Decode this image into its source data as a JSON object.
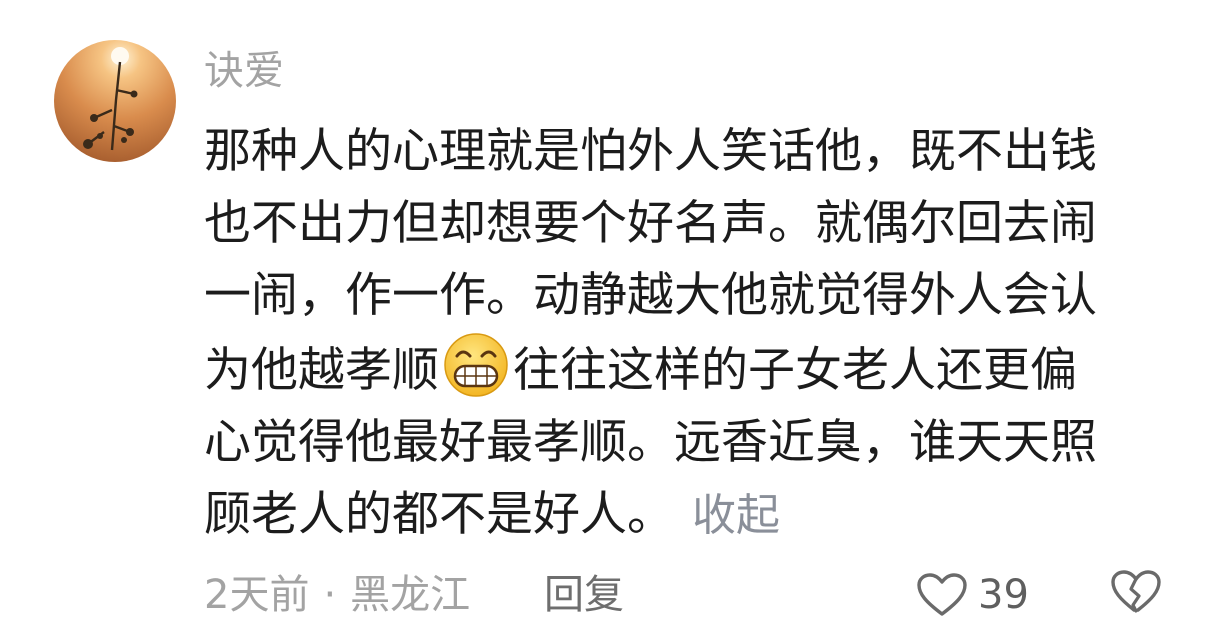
{
  "comment": {
    "username": "诀爱",
    "text_lines": [
      "那种人的心理就是怕外人笑话他，既不出钱",
      "也不出力但却想要个好名声。就偶尔回去闹",
      "一闹，作一作。动静越大他就觉得外人会认"
    ],
    "line4_before_emoji": "为他越孝顺",
    "line4_after_emoji": "往往这样的子女老人还更偏",
    "line5": "心觉得他最好最孝顺。远香近臭，谁天天照",
    "line6": "顾老人的都不是好人。",
    "collapse_label": "收起",
    "emoji_icon": "grinning-face-icon",
    "time": "2天前",
    "separator": "·",
    "location": "黑龙江",
    "reply_label": "回复",
    "like_count": "39",
    "colors": {
      "text": "#1c1c1c",
      "muted": "#a3a3a3",
      "collapse": "#8a8f99"
    }
  }
}
